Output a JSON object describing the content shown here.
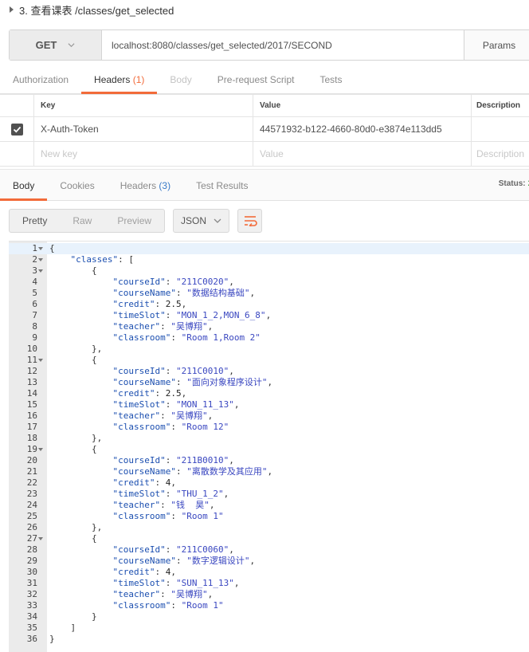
{
  "request": {
    "title": "3. 查看课表 /classes/get_selected",
    "method": "GET",
    "url": "localhost:8080/classes/get_selected/2017/SECOND",
    "params_label": "Params"
  },
  "request_tabs": [
    {
      "label": "Authorization",
      "count": ""
    },
    {
      "label": "Headers",
      "count": "(1)"
    },
    {
      "label": "Body",
      "count": ""
    },
    {
      "label": "Pre-request Script",
      "count": ""
    },
    {
      "label": "Tests",
      "count": ""
    }
  ],
  "headers_table": {
    "columns": [
      "Key",
      "Value",
      "Description"
    ],
    "rows": [
      {
        "key": "X-Auth-Token",
        "value": "44571932-b122-4660-80d0-e3874e113dd5",
        "description": "",
        "checked": true
      }
    ],
    "new_row": {
      "key": "New key",
      "value": "Value",
      "description": "Description"
    }
  },
  "response_tabs": [
    {
      "label": "Body",
      "count": ""
    },
    {
      "label": "Cookies",
      "count": ""
    },
    {
      "label": "Headers",
      "count": "(3)"
    },
    {
      "label": "Test Results",
      "count": ""
    }
  ],
  "status": {
    "label": "Status:",
    "value": "2"
  },
  "view_modes": [
    "Pretty",
    "Raw",
    "Preview"
  ],
  "format": "JSON",
  "icons": {
    "method_dropdown": "chevron-down-icon",
    "format_dropdown": "chevron-down-icon",
    "wrap": "wrap-lines-icon",
    "checkbox": "checkmark-icon",
    "collapse": "caret-right-icon"
  },
  "colors": {
    "accent": "#f26b3a",
    "json_key": "#1c4fb0",
    "json_string": "#3a47c0",
    "current_line": "#e8f2fc"
  },
  "response_body": {
    "classes": [
      {
        "courseId": "211C0020",
        "courseName": "数据结构基础",
        "credit": "2.5",
        "timeSlot": "MON_1_2,MON_6_8",
        "teacher": "吴博翔",
        "classroom": "Room 1,Room 2"
      },
      {
        "courseId": "211C0010",
        "courseName": "面向对象程序设计",
        "credit": "2.5",
        "timeSlot": "MON_11_13",
        "teacher": "吴博翔",
        "classroom": "Room 12"
      },
      {
        "courseId": "211B0010",
        "courseName": "离散数学及其应用",
        "credit": "4",
        "timeSlot": "THU_1_2",
        "teacher": "钱  昊",
        "classroom": "Room 1"
      },
      {
        "courseId": "211C0060",
        "courseName": "数字逻辑设计",
        "credit": "4",
        "timeSlot": "SUN_11_13",
        "teacher": "吴博翔",
        "classroom": "Room 1"
      }
    ]
  }
}
